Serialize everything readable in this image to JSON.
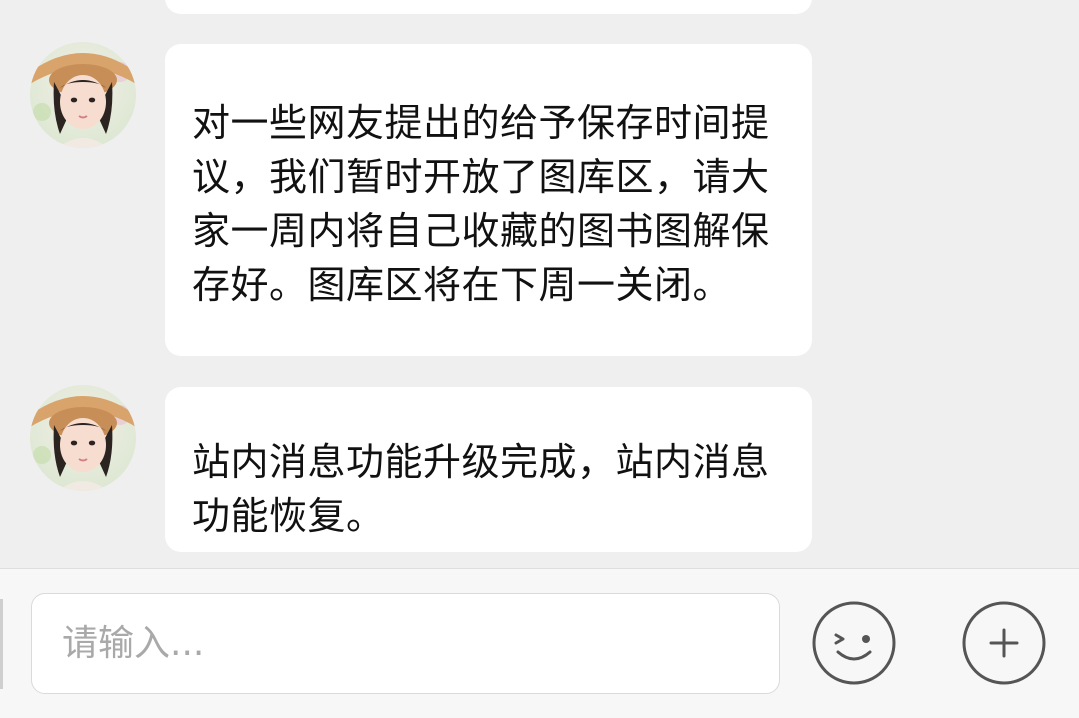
{
  "messages": [
    {
      "sender_avatar": "avatar-girl-with-hat",
      "text": "对一些网友提出的给予保存时间提议，我们暂时开放了图库区，请大家一周内将自己收藏的图书图解保存好。图库区将在下周一关闭。"
    },
    {
      "sender_avatar": "avatar-girl-with-hat",
      "text": "站内消息功能升级完成，站内消息功能恢复。"
    }
  ],
  "composer": {
    "placeholder": "请输入...",
    "value": "",
    "emoji_icon": "smiley-icon",
    "add_icon": "plus-circle-icon"
  },
  "colors": {
    "background": "#efefef",
    "bubble": "#ffffff",
    "text": "#111111",
    "placeholder": "#a9a9a9",
    "icon_stroke": "#555555"
  }
}
